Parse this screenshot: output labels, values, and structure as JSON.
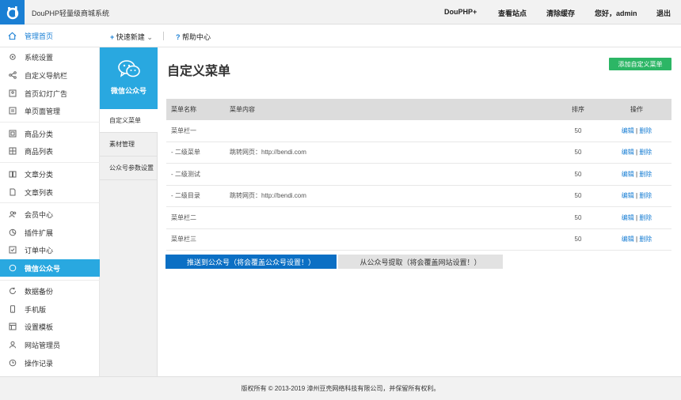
{
  "topbar": {
    "system_title": "DouPHP轻量级商城系统",
    "links": [
      "DouPHP+",
      "查看站点",
      "清除缓存",
      "您好，admin",
      "退出"
    ]
  },
  "subbar": {
    "home_label": "管理首页",
    "quick_add": "快速新建",
    "help": "帮助中心"
  },
  "sidebar": {
    "items": [
      {
        "label": "系统设置",
        "icon": "gear-icon"
      },
      {
        "label": "自定义导航栏",
        "icon": "share-icon"
      },
      {
        "label": "首页幻灯广告",
        "icon": "image-icon"
      },
      {
        "label": "单页面管理",
        "icon": "page-icon"
      },
      {
        "label": "商品分类",
        "icon": "grid-icon"
      },
      {
        "label": "商品列表",
        "icon": "list-icon"
      },
      {
        "label": "文章分类",
        "icon": "book-icon"
      },
      {
        "label": "文章列表",
        "icon": "file-icon"
      },
      {
        "label": "会员中心",
        "icon": "users-icon"
      },
      {
        "label": "插件扩展",
        "icon": "plugin-icon"
      },
      {
        "label": "订单中心",
        "icon": "order-icon"
      },
      {
        "label": "微信公众号",
        "icon": "wechat-icon"
      },
      {
        "label": "数据备份",
        "icon": "refresh-icon"
      },
      {
        "label": "手机版",
        "icon": "mobile-icon"
      },
      {
        "label": "设置模板",
        "icon": "template-icon"
      },
      {
        "label": "网站管理员",
        "icon": "user-icon"
      },
      {
        "label": "操作记录",
        "icon": "clock-icon"
      }
    ],
    "active_index": 11
  },
  "subpanel": {
    "title": "微信公众号",
    "items": [
      "自定义菜单",
      "素材管理",
      "公众号参数设置"
    ]
  },
  "main": {
    "title": "自定义菜单",
    "add_button": "添加自定义菜单",
    "columns": [
      "菜单名称",
      "菜单内容",
      "排序",
      "操作"
    ],
    "rows": [
      {
        "name": "菜单栏一",
        "content": "",
        "sort": "50"
      },
      {
        "name": "- 二级菜单",
        "content": "跳转网页：http://bendi.com",
        "sort": "50"
      },
      {
        "name": "- 二级测试",
        "content": "",
        "sort": "50"
      },
      {
        "name": "- 二级目录",
        "content": "跳转网页：http://bendi.com",
        "sort": "50"
      },
      {
        "name": "菜单栏二",
        "content": "",
        "sort": "50"
      },
      {
        "name": "菜单栏三",
        "content": "",
        "sort": "50"
      }
    ],
    "edit_label": "编辑",
    "separator": "|",
    "delete_label": "删除",
    "push_button": "推送到公众号（将会覆盖公众号设置！）",
    "pull_button": "从公众号提取（将会覆盖网站设置！）"
  },
  "footer": {
    "text": "版权所有 © 2013-2019 漳州豆壳网络科技有限公司，并保留所有权利。"
  }
}
